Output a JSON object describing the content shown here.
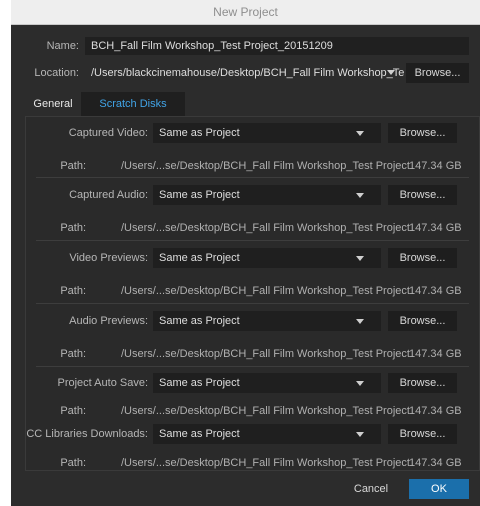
{
  "window": {
    "title": "New Project"
  },
  "name": {
    "label": "Name:",
    "value": "BCH_Fall Film Workshop_Test Project_20151209"
  },
  "location": {
    "label": "Location:",
    "value": "/Users/blackcinemahouse/Desktop/BCH_Fall Film Workshop_Te",
    "browse_label": "Browse..."
  },
  "tabs": [
    {
      "label": "General"
    },
    {
      "label": "Scratch Disks"
    }
  ],
  "scratch_disks": [
    {
      "label": "Captured Video:",
      "selected": "Same as Project",
      "browse_label": "Browse...",
      "path_label": "Path:",
      "path": "/Users/...se/Desktop/BCH_Fall Film Workshop_Test Project",
      "size": "147.34 GB"
    },
    {
      "label": "Captured Audio:",
      "selected": "Same as Project",
      "browse_label": "Browse...",
      "path_label": "Path:",
      "path": "/Users/...se/Desktop/BCH_Fall Film Workshop_Test Project",
      "size": "147.34 GB"
    },
    {
      "label": "Video Previews:",
      "selected": "Same as Project",
      "browse_label": "Browse...",
      "path_label": "Path:",
      "path": "/Users/...se/Desktop/BCH_Fall Film Workshop_Test Project",
      "size": "147.34 GB"
    },
    {
      "label": "Audio Previews:",
      "selected": "Same as Project",
      "browse_label": "Browse...",
      "path_label": "Path:",
      "path": "/Users/...se/Desktop/BCH_Fall Film Workshop_Test Project",
      "size": "147.34 GB"
    },
    {
      "label": "Project Auto Save:",
      "selected": "Same as Project",
      "browse_label": "Browse...",
      "path_label": "Path:",
      "path": "/Users/...se/Desktop/BCH_Fall Film Workshop_Test Project",
      "size": "147.34 GB"
    },
    {
      "label": "CC Libraries Downloads:",
      "selected": "Same as Project",
      "browse_label": "Browse...",
      "path_label": "Path:",
      "path": "/Users/...se/Desktop/BCH_Fall Film Workshop_Test Project",
      "size": "147.34 GB"
    }
  ],
  "footer": {
    "cancel_label": "Cancel",
    "ok_label": "OK"
  },
  "colors": {
    "accent": "#41a3e6",
    "ok_button": "#1b6fab",
    "dialog_bg": "#2c2c2c"
  }
}
